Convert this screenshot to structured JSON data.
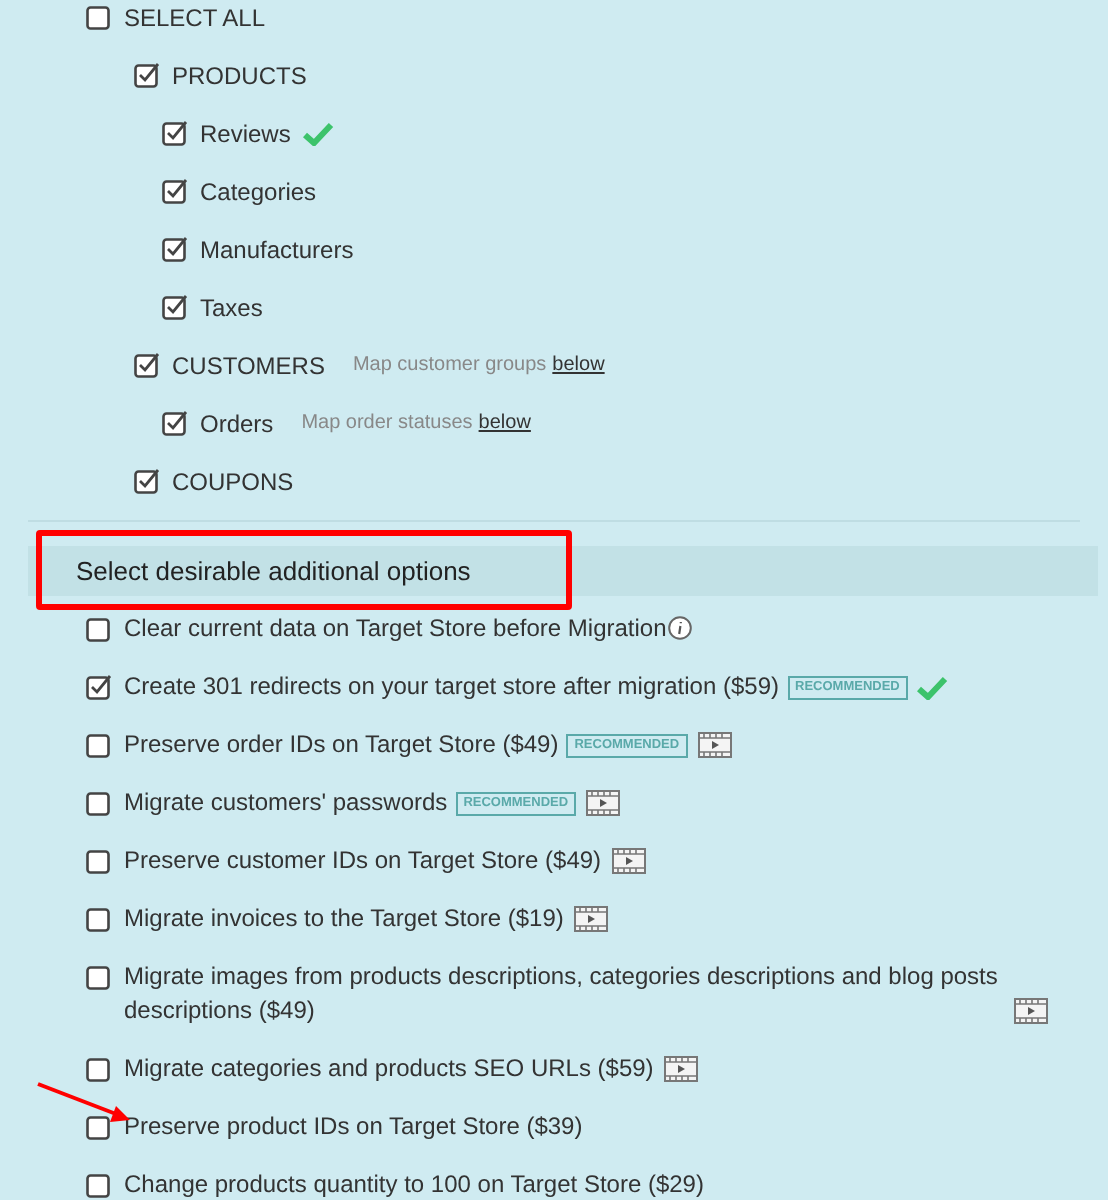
{
  "select_all": {
    "label": "SELECT ALL",
    "checked": false
  },
  "groups": [
    {
      "label": "PRODUCTS",
      "checked": true,
      "children": [
        {
          "label": "Reviews",
          "checked": true,
          "verified": true
        },
        {
          "label": "Categories",
          "checked": true,
          "verified": false
        },
        {
          "label": "Manufacturers",
          "checked": true,
          "verified": false
        },
        {
          "label": "Taxes",
          "checked": true,
          "verified": false
        }
      ]
    },
    {
      "label": "CUSTOMERS",
      "checked": true,
      "note": "Map customer groups",
      "note_link": "below",
      "children": [
        {
          "label": "Orders",
          "checked": true,
          "verified": false,
          "note": "Map order statuses",
          "note_link": "below"
        }
      ]
    },
    {
      "label": "COUPONS",
      "checked": true
    }
  ],
  "options_header": {
    "title": "Select desirable additional options",
    "highlighted": true
  },
  "options": [
    {
      "label": "Clear current data on Target Store before Migration",
      "checked": false,
      "info": true,
      "verified": false,
      "video": false,
      "pointed": false
    },
    {
      "label": "Create 301 redirects on your target store after migration ($59)",
      "checked": true,
      "badge": "RECOMMENDED",
      "info": false,
      "verified": true,
      "video": false,
      "pointed": false
    },
    {
      "label": "Preserve order IDs on Target Store ($49)",
      "checked": false,
      "badge": "RECOMMENDED",
      "info": false,
      "verified": false,
      "video": true,
      "pointed": false
    },
    {
      "label": "Migrate customers' passwords",
      "checked": false,
      "badge": "RECOMMENDED",
      "info": false,
      "verified": false,
      "video": true,
      "pointed": false
    },
    {
      "label": "Preserve customer IDs on Target Store ($49)",
      "checked": false,
      "info": false,
      "verified": false,
      "video": true,
      "pointed": false
    },
    {
      "label": "Migrate invoices to the Target Store ($19)",
      "checked": false,
      "info": false,
      "verified": false,
      "video": true,
      "pointed": false
    },
    {
      "label": "Migrate images from products descriptions, categories descriptions and blog posts descriptions ($49)",
      "checked": false,
      "info": false,
      "verified": false,
      "video": true,
      "pointed": false
    },
    {
      "label": "Migrate categories and products SEO URLs ($59)",
      "checked": false,
      "info": false,
      "verified": false,
      "video": true,
      "pointed": false
    },
    {
      "label": "Preserve product IDs on Target Store ($39)",
      "checked": false,
      "info": false,
      "verified": false,
      "video": false,
      "pointed": true
    },
    {
      "label": "Change products quantity to 100 on Target Store ($29)",
      "checked": false,
      "info": false,
      "verified": false,
      "video": false,
      "pointed": false
    }
  ]
}
